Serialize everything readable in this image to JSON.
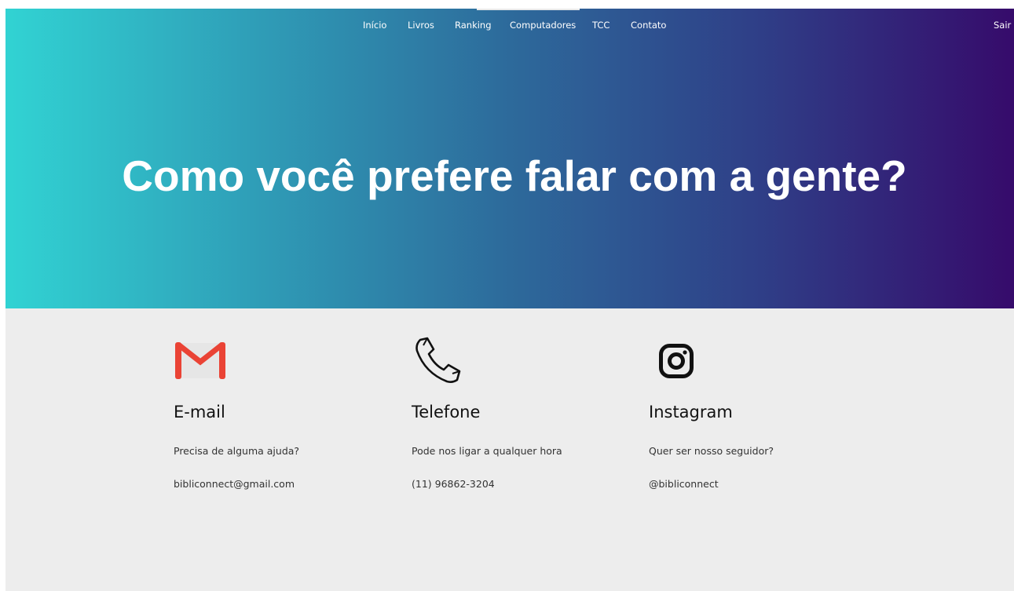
{
  "nav": {
    "items": [
      {
        "label": "Início"
      },
      {
        "label": "Livros"
      },
      {
        "label": "Ranking"
      },
      {
        "label": "Computadores"
      },
      {
        "label": "TCC"
      },
      {
        "label": "Contato"
      }
    ],
    "logout": "Sair"
  },
  "hero": {
    "title": "Como você prefere falar com a gente?"
  },
  "contacts": [
    {
      "icon": "gmail-icon",
      "title": "E-mail",
      "description": "Precisa de alguma ajuda?",
      "value": "bibliconnect@gmail.com"
    },
    {
      "icon": "phone-icon",
      "title": "Telefone",
      "description": "Pode nos ligar a qualquer hora",
      "value": "(11) 96862-3204"
    },
    {
      "icon": "instagram-icon",
      "title": "Instagram",
      "description": "Quer ser nosso seguidor?",
      "value": "@bibliconnect"
    }
  ],
  "colors": {
    "gradient_start": "#31d3d3",
    "gradient_end": "#360b6b",
    "content_background": "#ededed",
    "gmail_red": "#ea4335"
  }
}
